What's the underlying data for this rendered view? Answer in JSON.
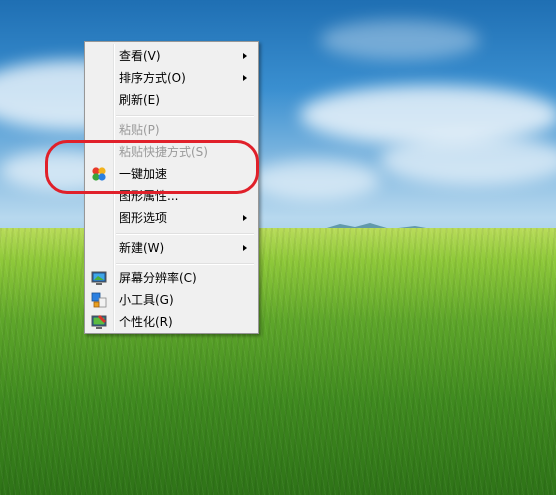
{
  "context_menu": {
    "items": [
      {
        "label": "查看(V)",
        "submenu": true,
        "disabled": false
      },
      {
        "label": "排序方式(O)",
        "submenu": true,
        "disabled": false
      },
      {
        "label": "刷新(E)",
        "submenu": false,
        "disabled": false
      },
      {
        "label": "粘贴(P)",
        "submenu": false,
        "disabled": true
      },
      {
        "label": "粘贴快捷方式(S)",
        "submenu": false,
        "disabled": true
      },
      {
        "label": "一键加速",
        "submenu": false,
        "disabled": false,
        "icon": "speedup-icon"
      },
      {
        "label": "图形属性...",
        "submenu": false,
        "disabled": false
      },
      {
        "label": "图形选项",
        "submenu": true,
        "disabled": false
      },
      {
        "label": "新建(W)",
        "submenu": true,
        "disabled": false
      },
      {
        "label": "屏幕分辨率(C)",
        "submenu": false,
        "disabled": false,
        "icon": "screen-resolution-icon"
      },
      {
        "label": "小工具(G)",
        "submenu": false,
        "disabled": false,
        "icon": "gadgets-icon"
      },
      {
        "label": "个性化(R)",
        "submenu": false,
        "disabled": false,
        "icon": "personalize-icon"
      }
    ]
  },
  "colors": {
    "menu_background": "#f0f0f0",
    "disabled_text": "#9a9a9a",
    "highlight_ring": "#e0202a"
  }
}
